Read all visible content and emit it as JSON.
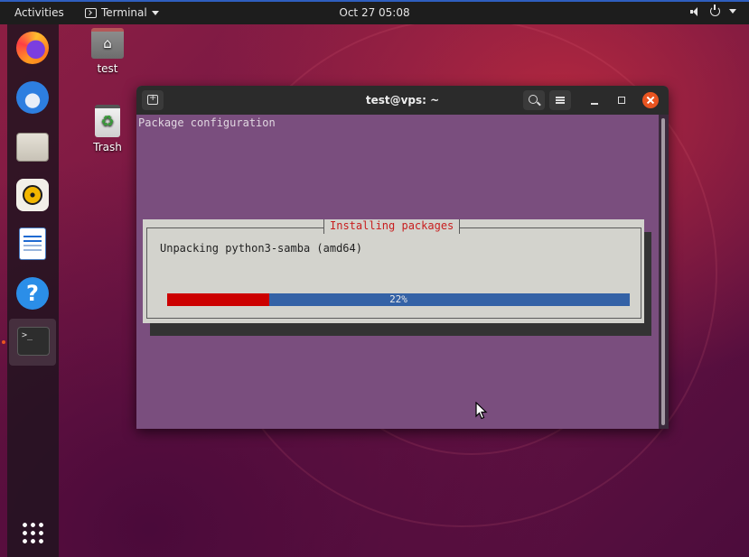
{
  "topbar": {
    "activities": "Activities",
    "app_name": "Terminal",
    "clock": "Oct 27  05:08"
  },
  "desktop": {
    "home_label": "test",
    "trash_label": "Trash"
  },
  "window": {
    "title": "test@vps: ~"
  },
  "terminal": {
    "heading": "Package configuration",
    "dialog_title": "Installing packages",
    "message": "Unpacking python3-samba (amd64)",
    "progress_percent": 22,
    "progress_label": "22%"
  },
  "colors": {
    "accent": "#e95420",
    "progress_fill": "#cc0000",
    "progress_track": "#3462a6",
    "terminal_bg": "#7a4e7e"
  }
}
